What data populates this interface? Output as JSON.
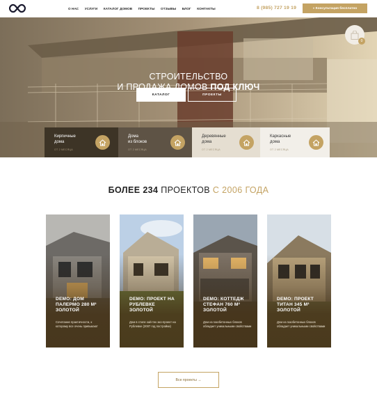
{
  "header": {
    "nav": [
      "О НАС",
      "УСЛУГИ",
      "КАТАЛОГ ДОМОВ",
      "ПРОЕКТЫ",
      "ОТЗЫВЫ",
      "БЛОГ",
      "КОНТАКТЫ"
    ],
    "phone": "8 (985) 727 19 19",
    "consult_label": "« Консультация бесплатно"
  },
  "hero": {
    "title_line1": "СТРОИТЕЛЬСТВО",
    "title_line2_prefix": "И ПРОДАЖА ДОМОВ ",
    "title_line2_bold": "ПОД КЛЮЧ",
    "btn_catalog": "КАТАЛОГ",
    "btn_projects": "ПРОЕКТЫ",
    "cart_count": "0"
  },
  "categories": [
    {
      "title": "Кирпичные дома",
      "l1": "Кирпичные",
      "l2": "дома",
      "sub": "ОТ 2 МЕСЯЦА",
      "bg": "#3d3426"
    },
    {
      "title": "Дома из блоков",
      "l1": "Дома",
      "l2": "из блоков",
      "sub": "ОТ 2 МЕСЯЦА",
      "bg": "#5e5345"
    },
    {
      "title": "Деревянные дома",
      "l1": "Деревянные",
      "l2": "дома",
      "sub": "ОТ 2 МЕСЯЦА",
      "bg": "#e5ded1"
    },
    {
      "title": "Каркасные дома",
      "l1": "Каркасные",
      "l2": "дома",
      "sub": "ОТ 2 МЕСЯЦА",
      "bg": "#f2efe9"
    }
  ],
  "projects_section": {
    "title_bold": "БОЛЕЕ 234",
    "title_mid": " ПРОЕКТОВ ",
    "title_gold": "С 2006 ГОДА"
  },
  "projects": [
    {
      "title": "DEMO: ДОМ ПАЛЕРМО 280 М² ЗОЛОТОЙ",
      "desc": "Сочетание практичности, к которому все очень привыкают"
    },
    {
      "title": "DEMO: ПРОЕКТ НА РУБЛЕВКЕ ЗОЛОТОЙ",
      "desc": "Дом в стиле хай-тек эко-проект на Рублевке (2007 год постройки)"
    },
    {
      "title": "DEMO: КОТТЕДЖ СТЕФАН 760 М² ЗОЛОТОЙ",
      "desc": "Дом из газобетонных блоков обладает уникальными свойствами"
    },
    {
      "title": "DEMO: ПРОЕКТ ТИТАН 345 М² ЗОЛОТОЙ",
      "desc": "Дом из газобетонных блоков обладает уникальными свойствами"
    }
  ],
  "all_projects_label": "Все проекты →",
  "colors": {
    "accent": "#c4a363",
    "dark": "#222222"
  }
}
